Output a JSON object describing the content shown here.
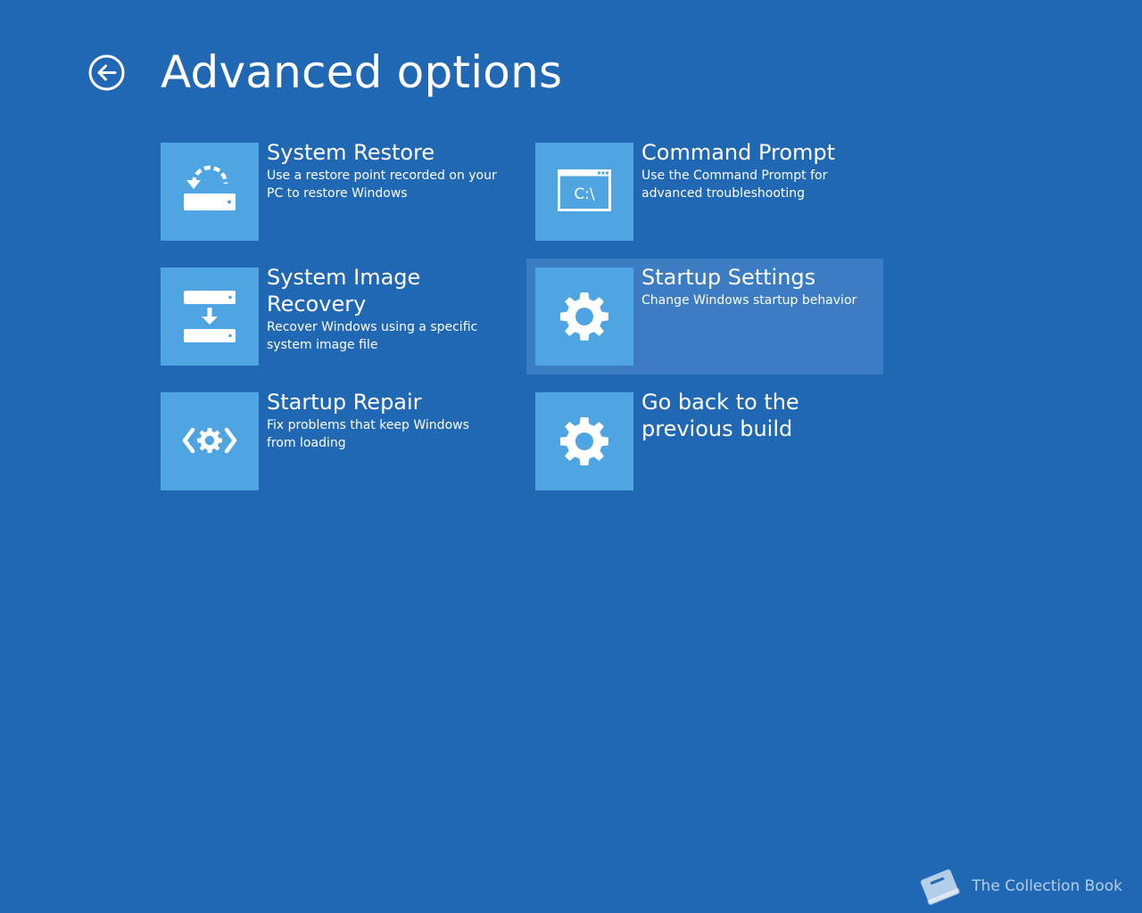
{
  "page": {
    "title": "Advanced options",
    "back_icon": "circle-arrow-left-icon"
  },
  "options": [
    {
      "title": "System Restore",
      "description": "Use a restore point recorded on your PC to restore Windows",
      "icon": "system-restore-icon"
    },
    {
      "title": "Command Prompt",
      "description": "Use the Command Prompt for advanced troubleshooting",
      "icon": "command-prompt-icon",
      "icon_text": "C:\\"
    },
    {
      "title": "System Image Recovery",
      "description": "Recover Windows using a specific system image file",
      "icon": "system-image-recovery-icon"
    },
    {
      "title": "Startup Settings",
      "description": "Change Windows startup behavior",
      "icon": "gear-icon",
      "selected": true
    },
    {
      "title": "Startup Repair",
      "description": "Fix problems that keep Windows from loading",
      "icon": "startup-repair-icon"
    },
    {
      "title": "Go back to the previous build",
      "description": "",
      "icon": "gear-icon"
    }
  ],
  "watermark": {
    "text": "The Collection Book",
    "icon": "book-icon"
  },
  "colors": {
    "background": "#2067b4",
    "tile_icon": "#4ea5e1",
    "tile_selected": "#3c7cc2",
    "text": "#ffffff"
  }
}
